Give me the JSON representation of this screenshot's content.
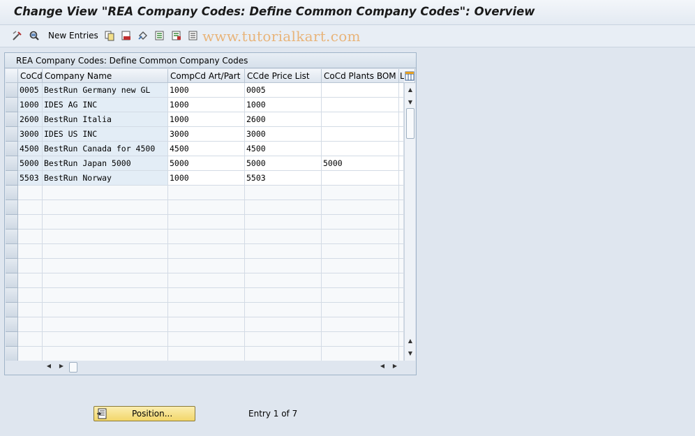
{
  "title": "Change View \"REA Company Codes: Define Common Company Codes\": Overview",
  "toolbar": {
    "new_entries": "New Entries",
    "watermark": "www.tutorialkart.com"
  },
  "panel": {
    "title": "REA Company Codes: Define Common Company Codes",
    "columns": [
      "CoCd",
      "Company Name",
      "CompCd Art/Part",
      "CCde Price List",
      "CoCd Plants BOM",
      "L"
    ],
    "rows": [
      {
        "cocd": "0005",
        "name": "BestRun Germany new GL",
        "art": "1000",
        "price": "0005",
        "bom": ""
      },
      {
        "cocd": "1000",
        "name": "IDES AG INC",
        "art": "1000",
        "price": "1000",
        "bom": ""
      },
      {
        "cocd": "2600",
        "name": "BestRun Italia",
        "art": "1000",
        "price": "2600",
        "bom": ""
      },
      {
        "cocd": "3000",
        "name": "IDES US INC",
        "art": "3000",
        "price": "3000",
        "bom": ""
      },
      {
        "cocd": "4500",
        "name": "BestRun Canada for 4500",
        "art": "4500",
        "price": "4500",
        "bom": ""
      },
      {
        "cocd": "5000",
        "name": "BestRun Japan 5000",
        "art": "5000",
        "price": "5000",
        "bom": "5000"
      },
      {
        "cocd": "5503",
        "name": "BestRun Norway",
        "art": "1000",
        "price": "5503",
        "bom": ""
      }
    ]
  },
  "footer": {
    "position_label": "Position...",
    "entry_info": "Entry 1 of 7"
  }
}
